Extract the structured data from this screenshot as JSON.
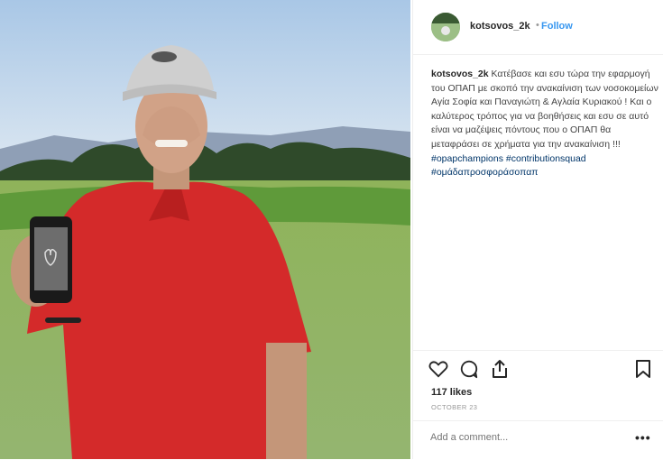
{
  "post": {
    "username": "kotsovos_2k",
    "separator": "•",
    "follow_label": "Follow",
    "caption_user": "kotsovos_2k",
    "caption_text": " Κατέβασε και εσυ τώρα την εφαρμογή του ΟΠΑΠ με σκοπό την ανακαίνιση των νοσοκομείων Αγία Σοφία και Παναγιώτη & Αγλαία Κυριακού ! Και ο καλύτερος τρόπος για να βοηθήσεις και εσυ σε αυτό είναι να μαζέψεις πόντους που ο ΟΠΑΠ θα μεταφράσει σε χρήματα για την ανακαίνιση !!! ",
    "hashtags": [
      "#opapchampions",
      "#contributionsquad",
      "#ομάδαπροσφοράσοπαπ"
    ],
    "likes": "117 likes",
    "date": "OCTOBER 23",
    "comment_placeholder": "Add a comment...",
    "more_label": "•••"
  },
  "icons": {
    "like": "heart-icon",
    "comment": "comment-icon",
    "share": "share-icon",
    "save": "bookmark-icon"
  },
  "colors": {
    "follow": "#3897f0",
    "hashtag": "#003569",
    "shirt": "#d42a2a"
  }
}
